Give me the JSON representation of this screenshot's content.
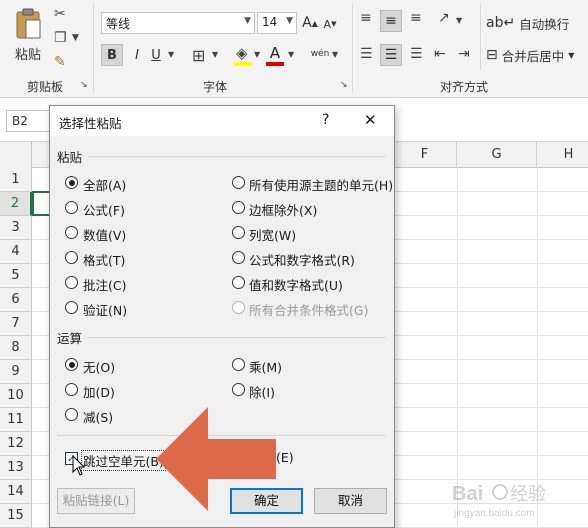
{
  "ribbon": {
    "clipboard": {
      "paste_label": "粘贴",
      "group_label": "剪贴板"
    },
    "font": {
      "font_name": "等线",
      "font_size": "14",
      "bold": "B",
      "italic": "I",
      "underline": "U",
      "font_color_letter": "A",
      "grow_font": "A",
      "shrink_font": "A",
      "phonetic": "wén",
      "group_label": "字体"
    },
    "alignment": {
      "wrap_text": "自动换行",
      "merge_center": "合并后居中",
      "group_label": "对齐方式"
    }
  },
  "formula_bar": {
    "name_box": "B2"
  },
  "grid": {
    "columns": [
      "F",
      "G",
      "H"
    ],
    "rows": [
      "1",
      "2",
      "3",
      "4",
      "5",
      "6",
      "7",
      "8",
      "9",
      "10",
      "11",
      "12",
      "13",
      "14",
      "15"
    ]
  },
  "dialog": {
    "title": "选择性粘贴",
    "help": "?",
    "close": "✕",
    "paste_section": "粘贴",
    "paste_options_left": [
      {
        "label": "全部(A)",
        "checked": true
      },
      {
        "label": "公式(F)",
        "checked": false
      },
      {
        "label": "数值(V)",
        "checked": false
      },
      {
        "label": "格式(T)",
        "checked": false
      },
      {
        "label": "批注(C)",
        "checked": false
      },
      {
        "label": "验证(N)",
        "checked": false
      }
    ],
    "paste_options_right": [
      {
        "label": "所有使用源主题的单元(H)",
        "enabled": true
      },
      {
        "label": "边框除外(X)",
        "enabled": true
      },
      {
        "label": "列宽(W)",
        "enabled": true
      },
      {
        "label": "公式和数字格式(R)",
        "enabled": true
      },
      {
        "label": "值和数字格式(U)",
        "enabled": true
      },
      {
        "label": "所有合并条件格式(G)",
        "enabled": false
      }
    ],
    "operation_section": "运算",
    "operation_options_left": [
      {
        "label": "无(O)",
        "checked": true
      },
      {
        "label": "加(D)",
        "checked": false
      },
      {
        "label": "减(S)",
        "checked": false
      }
    ],
    "operation_options_right": [
      {
        "label": "乘(M)",
        "checked": false
      },
      {
        "label": "除(I)",
        "checked": false
      }
    ],
    "skip_blanks": {
      "label": "跳过空单元(B)",
      "checked": true
    },
    "transpose_partial": "(E)",
    "paste_link_button": "粘贴链接(L)",
    "ok_button": "确定",
    "cancel_button": "取消"
  },
  "colors": {
    "arrow": "#dc6a48",
    "accent": "#0078d7",
    "ribbon_bg": "#f3f3f3",
    "dialog_bg": "#f0f0f0"
  }
}
